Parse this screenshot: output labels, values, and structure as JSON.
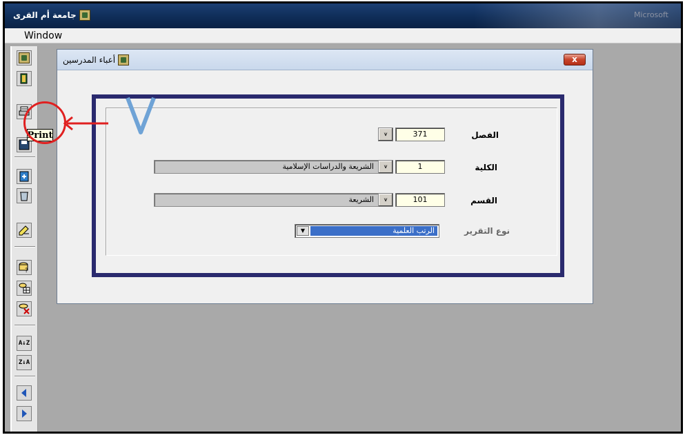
{
  "app": {
    "title": "جامعة أم القرى",
    "ghost_title": "Microsoft"
  },
  "menu": {
    "window_label": "Window"
  },
  "toolbar": {
    "print_tooltip": "Print",
    "buttons": [
      "exit-icon",
      "print-icon",
      "save-icon",
      "new-record-icon",
      "delete-icon",
      "edit-icon",
      "query-icon",
      "table-icon",
      "clear-query-icon",
      "sort-ascending-icon",
      "sort-descending-icon",
      "prev-icon",
      "next-icon"
    ],
    "sort_asc": "A↓Z",
    "sort_desc": "Z↓A"
  },
  "annotation": {
    "step_number": "٧",
    "highlight_color": "#e02020",
    "number_color": "#6fa3d6"
  },
  "form": {
    "title": "أعباء المدرسين",
    "close_label": "x",
    "semester": {
      "label": "الفصل",
      "value": "371"
    },
    "college": {
      "label": "الكلية",
      "value": "1",
      "description": "الشريعة والدراسات الإسلامية"
    },
    "department": {
      "label": "القسم",
      "value": "101",
      "description": "الشريعة"
    },
    "report_type": {
      "label": "نوع التقرير",
      "selected": "الرتب العلمية"
    },
    "lookup_symbol": "⩛"
  },
  "colors": {
    "frame_border": "#2a2a6e",
    "titlebar": "#0f2d58",
    "selection": "#3b6fc8"
  }
}
